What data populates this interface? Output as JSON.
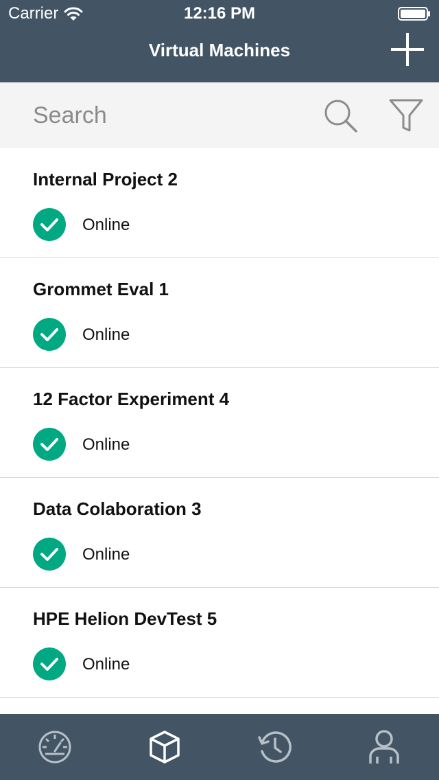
{
  "status_bar": {
    "carrier": "Carrier",
    "time": "12:16 PM"
  },
  "nav": {
    "title": "Virtual Machines",
    "add_icon": "plus-icon"
  },
  "search": {
    "placeholder": "Search",
    "value": "",
    "search_icon": "search-icon",
    "filter_icon": "filter-icon"
  },
  "vms": [
    {
      "name": "Internal Project 2",
      "status": "Online"
    },
    {
      "name": "Grommet Eval 1",
      "status": "Online"
    },
    {
      "name": "12 Factor Experiment 4",
      "status": "Online"
    },
    {
      "name": "Data Colaboration 3",
      "status": "Online"
    },
    {
      "name": "HPE Helion DevTest 5",
      "status": "Online"
    }
  ],
  "tabs": [
    {
      "icon": "dashboard-icon",
      "active": false
    },
    {
      "icon": "cube-icon",
      "active": true
    },
    {
      "icon": "history-icon",
      "active": false
    },
    {
      "icon": "user-icon",
      "active": false
    }
  ],
  "colors": {
    "header_bg": "#435564",
    "status_ok": "#01a982",
    "search_bg": "#f4f4f4",
    "tab_inactive": "#b7c0c7",
    "tab_active": "#ffffff"
  }
}
